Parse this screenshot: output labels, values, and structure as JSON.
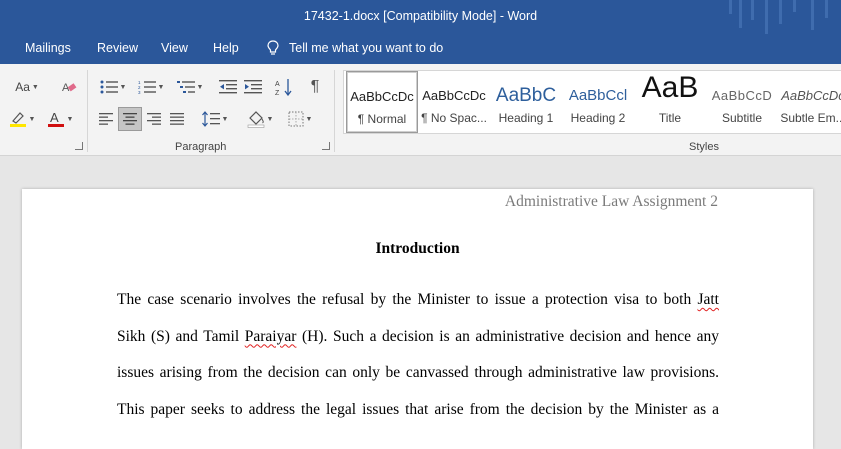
{
  "window": {
    "title": "17432-1.docx [Compatibility Mode]  -  Word"
  },
  "menu": {
    "tabs": [
      "Mailings",
      "Review",
      "View",
      "Help"
    ],
    "tell_me": "Tell me what you want to do"
  },
  "ribbon": {
    "font_size_button": "Aa",
    "paragraph_label": "Paragraph",
    "styles_label": "Styles",
    "styles": [
      {
        "sample": "AaBbCcDc",
        "name": "¶ Normal"
      },
      {
        "sample": "AaBbCcDc",
        "name": "¶ No Spac..."
      },
      {
        "sample": "AaBbC",
        "name": "Heading 1"
      },
      {
        "sample": "AaBbCcl",
        "name": "Heading 2"
      },
      {
        "sample": "AaB",
        "name": "Title"
      },
      {
        "sample": "AaBbCcD",
        "name": "Subtitle"
      },
      {
        "sample": "AaBbCcDc",
        "name": "Subtle Em..."
      }
    ]
  },
  "document": {
    "header": "Administrative Law Assignment 2",
    "heading": "Introduction",
    "lines": [
      "The case scenario involves the refusal by the Minister to issue a protection visa to both Jatt",
      "Sikh (S) and Tamil Paraiyar (H). Such a decision is an administrative decision and hence any",
      "issues arising from the decision can only be canvassed through administrative law provisions.",
      "This paper seeks to address the legal issues that arise from the decision by the Minister as a"
    ],
    "spellcheck_words": [
      "Jatt",
      "Paraiyar"
    ]
  },
  "colors": {
    "title_bar": "#2b579a",
    "ribbon": "#f3f3f3",
    "page": "#ffffff",
    "canvas": "#e6e6e6"
  }
}
